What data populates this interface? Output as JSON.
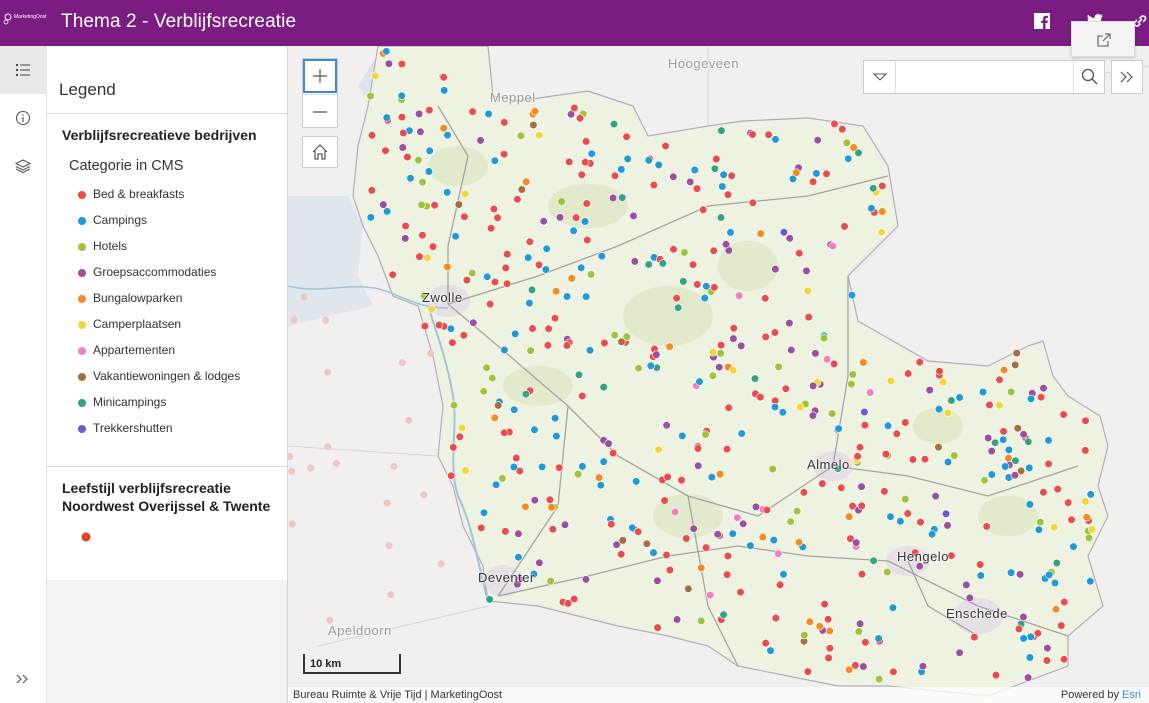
{
  "header": {
    "title": "Thema 2 - Verblijfsrecreatie",
    "logo_text": "MarketingOost",
    "bg_color": "#7b1c82"
  },
  "rail": {
    "items": [
      {
        "icon": "legend-icon",
        "active": true
      },
      {
        "icon": "info-icon",
        "active": false
      },
      {
        "icon": "layers-icon",
        "active": false
      }
    ]
  },
  "legend": {
    "heading": "Legend",
    "layer1": {
      "title": "Verblijfsrecreatieve bedrijven",
      "field": "Categorie in CMS",
      "classes": [
        {
          "label": "Bed & breakfasts",
          "color": "#e84c4c"
        },
        {
          "label": "Campings",
          "color": "#1f9ad6"
        },
        {
          "label": "Hotels",
          "color": "#9dc43c"
        },
        {
          "label": "Groepsaccommodaties",
          "color": "#9b4fa0"
        },
        {
          "label": "Bungalowparken",
          "color": "#f28b24"
        },
        {
          "label": "Camperplaatsen",
          "color": "#f5d639"
        },
        {
          "label": "Appartementen",
          "color": "#ef7fc4"
        },
        {
          "label": "Vakantiewoningen & lodges",
          "color": "#a66d3f"
        },
        {
          "label": "Minicampings",
          "color": "#35a383"
        },
        {
          "label": "Trekkershutten",
          "color": "#6a5acd"
        }
      ]
    },
    "layer2": {
      "title": "Leefstijl verblijfsrecreatie Noordwest Overijssel & Twente"
    }
  },
  "map": {
    "places": [
      "Hoogeveen",
      "Meppel",
      "Zwolle",
      "Almelo",
      "Hengelo",
      "Enschede",
      "Deventer",
      "Apeldoorn"
    ],
    "search_placeholder": "",
    "scale_label": "10 km",
    "attribution_left": "Bureau Ruimte & Vrije Tijd | MarketingOost",
    "attribution_powered": "Powered by ",
    "attribution_esri": "Esri"
  }
}
